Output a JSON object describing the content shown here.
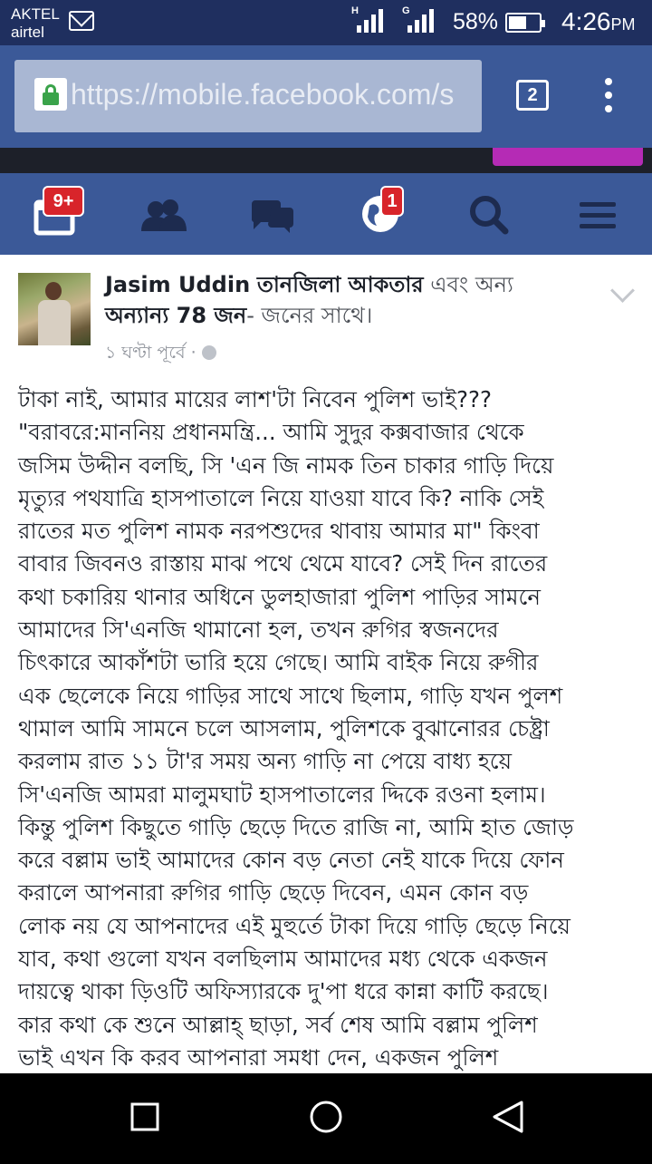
{
  "status_bar": {
    "carrier_line1": "AKTEL",
    "carrier_line2": "airtel",
    "signal1_label": "H",
    "signal2_label": "G",
    "battery_percent": "58%",
    "battery_level": 0.58,
    "time": "4:26",
    "time_suffix": "PM"
  },
  "browser": {
    "url": "https://mobile.facebook.com/s",
    "tab_count": "2"
  },
  "nav": {
    "notifications_badge": "9+",
    "globe_badge": "1"
  },
  "post": {
    "author": "Jasim Uddin",
    "tagged": "তানজিলা আকতার",
    "and_others_text": "এবং অন্য",
    "others_count": "অন্যান্য 78 জন",
    "with_text": "- জনের সাথে।",
    "time": "১ ঘণ্টা পূর্বে ·",
    "body": "টাকা নাই, আমার মায়ের লাশ'টা নিবেন পুলিশ ভাই???\n\"বরাবরে:মাননিয় প্রধানমন্ত্রি... আমি সুদুর কক্সবাজার থেকে\nজসিম উদ্দীন বলছি, সি 'এন জি নামক তিন চাকার গাড়ি দিয়ে\nমৃত্যুর পথযাত্রি হাসপাতালে নিয়ে যাওয়া যাবে কি? নাকি সেই\nরাতের মত পুলিশ নামক নরপশুদের থাবায় আমার মা\" কিংবা\nবাবার জিবনও রাস্তায় মাঝ পথে থেমে যাবে? সেই দিন রাতের\nকথা চকারিয় থানার অধিনে ডুলহাজারা পুলিশ পাড়ির সামনে\nআমাদের সি'এনজি থামানো হল, তখন রুগির স্বজনদের\nচিৎকারে আকাঁশটা ভারি হয়ে গেছে। আমি বাইক নিয়ে রুগীর\nএক ছেলেকে নিয়ে গাড়ির সাথে সাথে ছিলাম, গাড়ি যখন পুলশ\nথামাল আমি সামনে চলে আসলাম, পুলিশকে বুঝানোরর চেষ্ট্রা\nকরলাম রাত ১১ টা'র সময় অন্য গাড়ি না পেয়ে বাধ্য হয়ে\nসি'এনজি আমরা মালুমঘাট হাসপাতালের দ্দিকে রওনা হলাম।\nকিন্তু পুলিশ কিছুতে গাড়ি ছেড়ে দিতে রাজি না, আমি হাত জোড়\nকরে বল্লাম ভাই আমাদের কোন বড় নেতা নেই যাকে দিয়ে ফোন\nকরালে আপনারা রুগির গাড়ি ছেড়ে দিবেন, এমন কোন বড়\nলোক নয় যে আপনাদের এই মুহুর্তে টাকা দিয়ে গাড়ি ছেড়ে নিয়ে\nযাব, কথা গুলো যখন বলছিলাম আমাদের মধ্য থেকে একজন\nদায়ত্বে থাকা ড়িওটি অফিস্যারকে দু'পা ধরে কান্না কাটি করছে।\nকার কথা কে শুনে আল্লাহ্ ছাড়া, সর্ব শেষ আমি বল্লাম পুলিশ\nভাই এখন কি করব আপনারা সমধা দেন, একজন পুলিশ"
  },
  "icons": {
    "notifications": "calendar-notification-icon",
    "friends": "friend-requests-icon",
    "messages": "messages-icon",
    "globe": "globe-icon",
    "search": "search-icon",
    "menu": "hamburger-menu-icon"
  },
  "colors": {
    "facebook_blue": "#3b5998",
    "badge_red": "#d8242a",
    "banner_button": "#b52bb5"
  }
}
